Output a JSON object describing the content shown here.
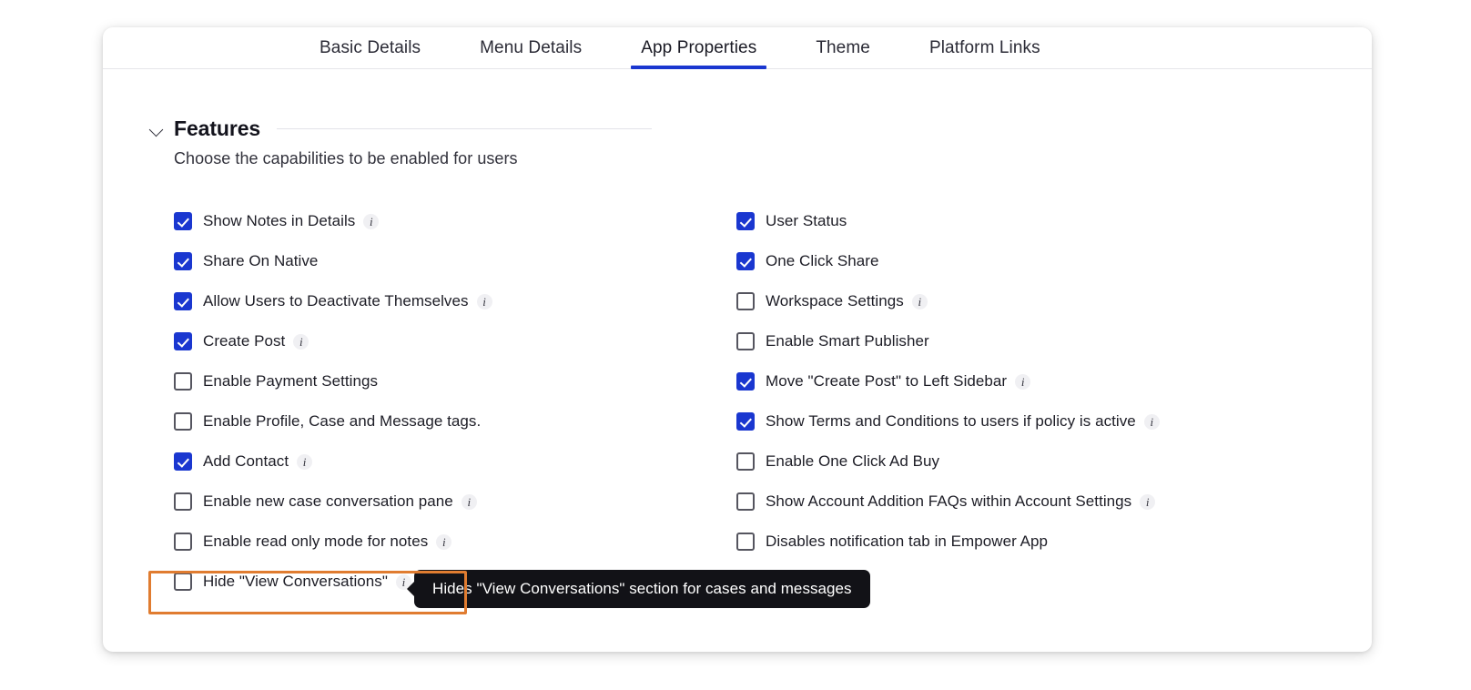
{
  "tabs": [
    {
      "label": "Basic Details",
      "active": false
    },
    {
      "label": "Menu Details",
      "active": false
    },
    {
      "label": "App Properties",
      "active": true
    },
    {
      "label": "Theme",
      "active": false
    },
    {
      "label": "Platform Links",
      "active": false
    }
  ],
  "section": {
    "title": "Features",
    "subtitle": "Choose the capabilities to be enabled for users",
    "collapse_icon": "chevron-down-icon"
  },
  "features_left": [
    {
      "label": "Show Notes in Details",
      "checked": true,
      "info": true
    },
    {
      "label": "Share On Native",
      "checked": true,
      "info": false
    },
    {
      "label": "Allow Users to Deactivate Themselves",
      "checked": true,
      "info": true
    },
    {
      "label": "Create Post",
      "checked": true,
      "info": true
    },
    {
      "label": "Enable Payment Settings",
      "checked": false,
      "info": false
    },
    {
      "label": "Enable Profile, Case and Message tags.",
      "checked": false,
      "info": false
    },
    {
      "label": "Add Contact",
      "checked": true,
      "info": true
    },
    {
      "label": "Enable new case conversation pane",
      "checked": false,
      "info": true
    },
    {
      "label": "Enable read only mode for notes",
      "checked": false,
      "info": true
    },
    {
      "label": "Hide \"View Conversations\"",
      "checked": false,
      "info": true
    }
  ],
  "features_right": [
    {
      "label": "User Status",
      "checked": true,
      "info": false
    },
    {
      "label": "One Click Share",
      "checked": true,
      "info": false
    },
    {
      "label": "Workspace Settings",
      "checked": false,
      "info": true
    },
    {
      "label": "Enable Smart Publisher",
      "checked": false,
      "info": false
    },
    {
      "label": "Move \"Create Post\" to Left Sidebar",
      "checked": true,
      "info": true
    },
    {
      "label": "Show Terms and Conditions to users if policy is active",
      "checked": true,
      "info": true
    },
    {
      "label": "Enable One Click Ad Buy",
      "checked": false,
      "info": false
    },
    {
      "label": "Show Account Addition FAQs within Account Settings",
      "checked": false,
      "info": true
    },
    {
      "label": "Disables notification tab in Empower App",
      "checked": false,
      "info": false
    }
  ],
  "tooltip": {
    "text": "Hides \"View Conversations\" section for cases and messages"
  },
  "info_icon_glyph": "i",
  "colors": {
    "accent_blue": "#1a37d0",
    "highlight_orange": "#e07c30",
    "tooltip_bg": "#121217"
  }
}
